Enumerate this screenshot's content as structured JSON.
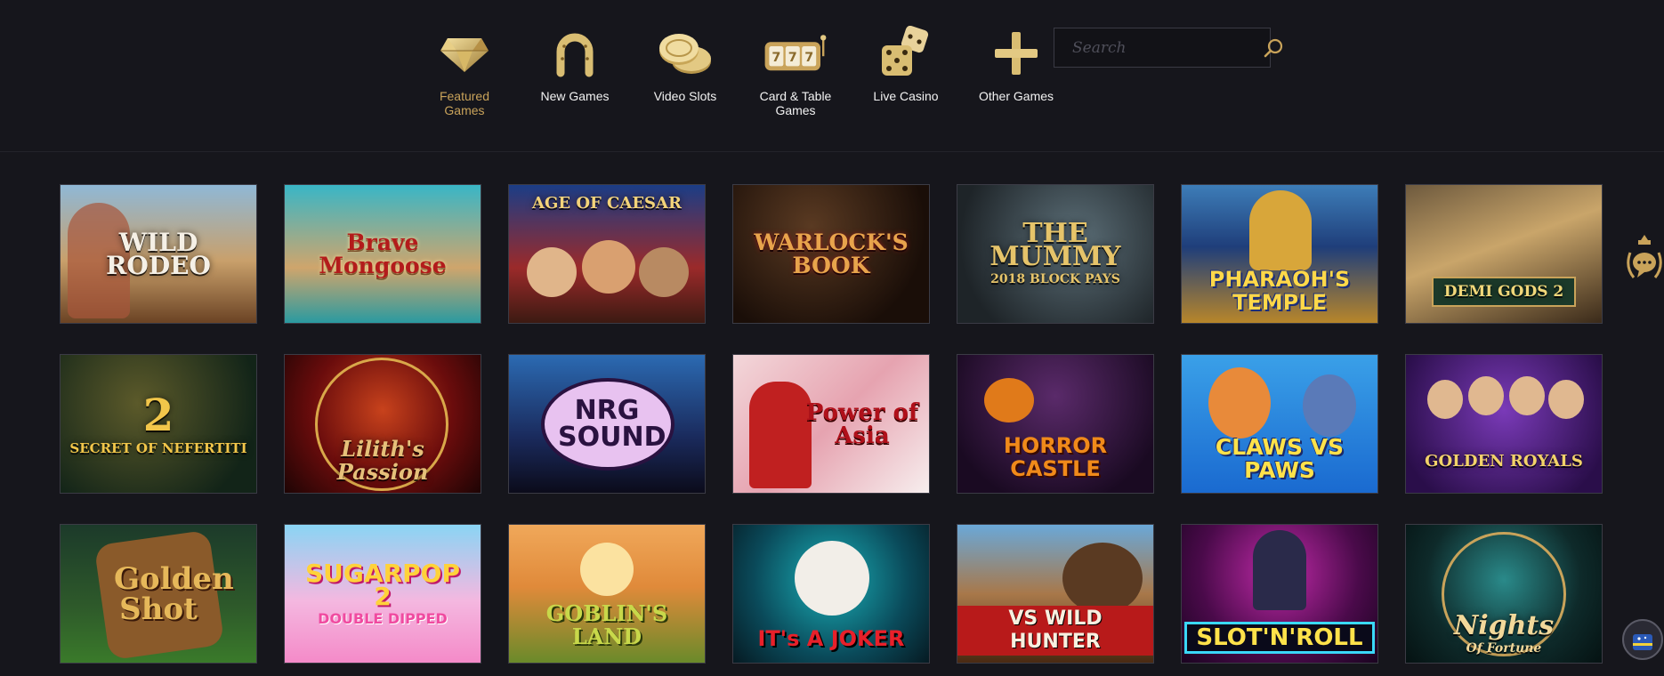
{
  "nav": {
    "items": [
      {
        "label": "Featured\nGames",
        "icon": "diamond-icon",
        "active": true
      },
      {
        "label": "New Games",
        "icon": "horseshoe-icon",
        "active": false
      },
      {
        "label": "Video Slots",
        "icon": "coins-icon",
        "active": false
      },
      {
        "label": "Card & Table\nGames",
        "icon": "slot-machine-icon",
        "active": false
      },
      {
        "label": "Live Casino",
        "icon": "dice-icon",
        "active": false
      },
      {
        "label": "Other Games",
        "icon": "plus-icon",
        "active": false
      }
    ]
  },
  "search": {
    "placeholder": "Search"
  },
  "games": [
    {
      "title": "WILD RODEO",
      "sub": ""
    },
    {
      "title": "Brave Mongoose",
      "sub": ""
    },
    {
      "title": "AGE OF CAESAR",
      "sub": ""
    },
    {
      "title": "WARLOCK'S BOOK",
      "sub": ""
    },
    {
      "title": "THE MUMMY",
      "sub": "2018 BLOCK PAYS"
    },
    {
      "title": "PHARAOH'S TEMPLE",
      "sub": ""
    },
    {
      "title": "DEMI GODS 2",
      "sub": ""
    },
    {
      "title": "2",
      "sub": "SECRET OF NEFERTITI"
    },
    {
      "title": "Lilith's Passion",
      "sub": ""
    },
    {
      "title": "NRG SOUND",
      "sub": ""
    },
    {
      "title": "Power of Asia",
      "sub": ""
    },
    {
      "title": "HORROR CASTLE",
      "sub": ""
    },
    {
      "title": "CLAWS VS PAWS",
      "sub": ""
    },
    {
      "title": "GOLDEN ROYALS",
      "sub": ""
    },
    {
      "title": "Golden Shot",
      "sub": ""
    },
    {
      "title": "SUGARPOP 2",
      "sub": "DOUBLE DIPPED"
    },
    {
      "title": "GOBLIN'S LAND",
      "sub": ""
    },
    {
      "title": "IT's A JOKER",
      "sub": ""
    },
    {
      "title": "VS WILD HUNTER",
      "sub": ""
    },
    {
      "title": "SLOT'N'ROLL",
      "sub": ""
    },
    {
      "title": "Nights",
      "sub": "Of Fortune"
    }
  ],
  "theme": {
    "accent": "#c9a35a",
    "background": "#16161c",
    "tile_border": "#3b3b45"
  }
}
